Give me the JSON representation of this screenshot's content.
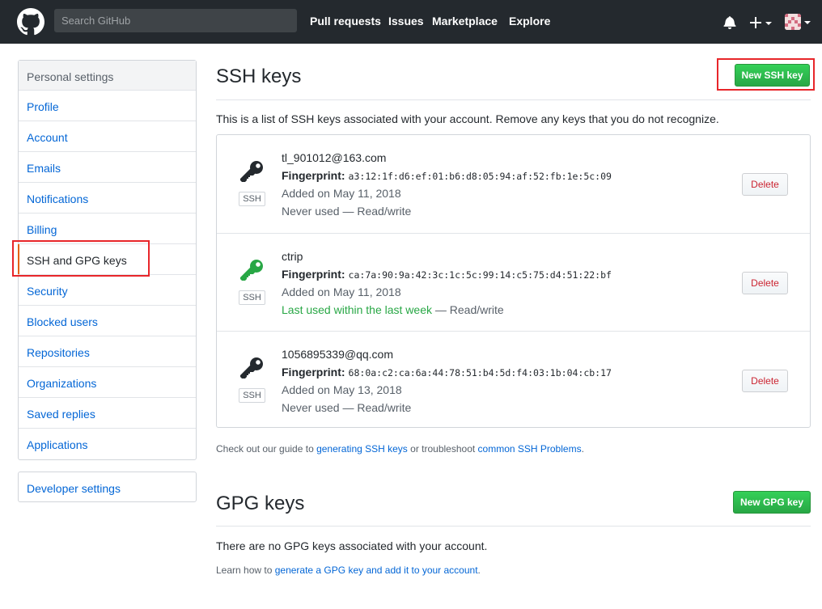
{
  "header": {
    "search_placeholder": "Search GitHub",
    "nav": [
      "Pull requests",
      "Issues",
      "Marketplace",
      "Explore"
    ],
    "icons": [
      "github-logo-icon",
      "bell-icon",
      "plus-icon",
      "avatar"
    ]
  },
  "sidebar": {
    "heading": "Personal settings",
    "items": [
      {
        "label": "Profile"
      },
      {
        "label": "Account"
      },
      {
        "label": "Emails"
      },
      {
        "label": "Notifications"
      },
      {
        "label": "Billing"
      },
      {
        "label": "SSH and GPG keys",
        "selected": true
      },
      {
        "label": "Security"
      },
      {
        "label": "Blocked users"
      },
      {
        "label": "Repositories"
      },
      {
        "label": "Organizations"
      },
      {
        "label": "Saved replies"
      },
      {
        "label": "Applications"
      }
    ],
    "developer": "Developer settings"
  },
  "ssh": {
    "title": "SSH keys",
    "new_button": "New SSH key",
    "intro": "This is a list of SSH keys associated with your account. Remove any keys that you do not recognize.",
    "keys": [
      {
        "title": "tl_901012@163.com",
        "fingerprint_label": "Fingerprint:",
        "fingerprint": "a3:12:1f:d6:ef:01:b6:d8:05:94:af:52:fb:1e:5c:09",
        "added": "Added on May 11, 2018",
        "usage": "Never used",
        "usage_sep": " — ",
        "access": "Read/write",
        "badge": "SSH",
        "delete": "Delete",
        "icon_color": "#24292e"
      },
      {
        "title": "ctrip",
        "fingerprint_label": "Fingerprint:",
        "fingerprint": "ca:7a:90:9a:42:3c:1c:5c:99:14:c5:75:d4:51:22:bf",
        "added": "Added on May 11, 2018",
        "usage": "Last used within the last week",
        "usage_sep": " — ",
        "access": "Read/write",
        "badge": "SSH",
        "delete": "Delete",
        "icon_color": "#28a745"
      },
      {
        "title": "1056895339@qq.com",
        "fingerprint_label": "Fingerprint:",
        "fingerprint": "68:0a:c2:ca:6a:44:78:51:b4:5d:f4:03:1b:04:cb:17",
        "added": "Added on May 13, 2018",
        "usage": "Never used",
        "usage_sep": " — ",
        "access": "Read/write",
        "badge": "SSH",
        "delete": "Delete",
        "icon_color": "#24292e"
      }
    ],
    "note_prefix": "Check out our guide to ",
    "note_link1": "generating SSH keys",
    "note_middle": " or troubleshoot ",
    "note_link2": "common SSH Problems",
    "note_suffix": "."
  },
  "gpg": {
    "title": "GPG keys",
    "new_button": "New GPG key",
    "empty": "There are no GPG keys associated with your account.",
    "note_prefix": "Learn how to ",
    "note_link": "generate a GPG key and add it to your account",
    "note_suffix": "."
  },
  "colors": {
    "header_bg": "#24292e",
    "link": "#0366d6",
    "green": "#28a745",
    "danger": "#cb2431",
    "highlight_box": "#e8262a"
  }
}
